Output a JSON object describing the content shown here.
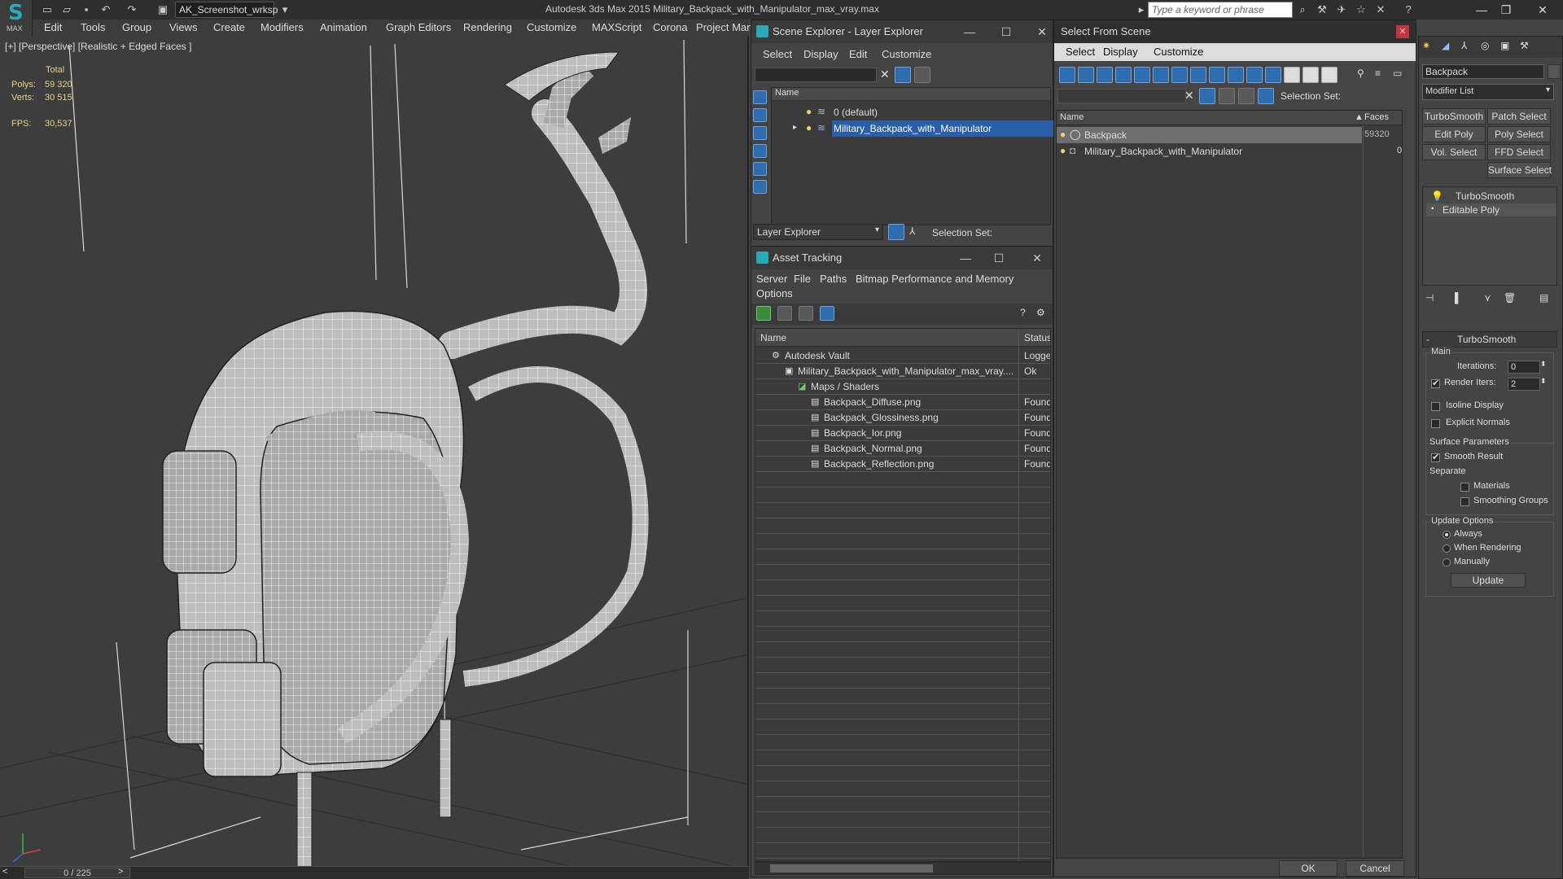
{
  "app": {
    "logo_text": "MAX",
    "title": "Autodesk 3ds Max  2015     Military_Backpack_with_Manipulator_max_vray.max",
    "workspace": "AK_Screenshot_wrksp",
    "search_placeholder": "Type a keyword or phrase"
  },
  "menu": [
    "Edit",
    "Tools",
    "Group",
    "Views",
    "Create",
    "Modifiers",
    "Animation",
    "Graph Editors",
    "Rendering",
    "Customize",
    "MAXScript",
    "Corona",
    "Project Man"
  ],
  "viewport": {
    "label": "[+] [Perspective] [Realistic + Edged Faces ]",
    "stats": {
      "total_label": "Total",
      "polys_label": "Polys:",
      "polys": "59 320",
      "verts_label": "Verts:",
      "verts": "30 515",
      "fps_label": "FPS:",
      "fps": "30,537"
    }
  },
  "timeline": {
    "frame": "0 / 225"
  },
  "scene_explorer": {
    "title": "Scene Explorer - Layer Explorer",
    "menu": [
      "Select",
      "Display",
      "Edit",
      "Customize"
    ],
    "col_name": "Name",
    "rows": [
      "0 (default)",
      "Military_Backpack_with_Manipulator"
    ],
    "footer_combo": "Layer Explorer",
    "selection_set": "Selection Set:"
  },
  "asset_tracking": {
    "title": "Asset Tracking",
    "menu": [
      "Server",
      "File",
      "Paths",
      "Bitmap Performance and Memory",
      "Options"
    ],
    "col_name": "Name",
    "col_status": "Status",
    "rows": [
      {
        "name": "Autodesk Vault",
        "status": "Logged",
        "indent": 0
      },
      {
        "name": "Military_Backpack_with_Manipulator_max_vray....",
        "status": "Ok",
        "indent": 1
      },
      {
        "name": "Maps / Shaders",
        "status": "",
        "indent": 2
      },
      {
        "name": "Backpack_Diffuse.png",
        "status": "Found",
        "indent": 3
      },
      {
        "name": "Backpack_Glossiness.png",
        "status": "Found",
        "indent": 3
      },
      {
        "name": "Backpack_Ior.png",
        "status": "Found",
        "indent": 3
      },
      {
        "name": "Backpack_Normal.png",
        "status": "Found",
        "indent": 3
      },
      {
        "name": "Backpack_Reflection.png",
        "status": "Found",
        "indent": 3
      }
    ]
  },
  "select_from_scene": {
    "title": "Select From Scene",
    "menu": [
      "Select",
      "Display",
      "Customize"
    ],
    "selection_set": "Selection Set:",
    "col_name": "Name",
    "col_faces": "Faces",
    "rows": [
      {
        "name": "Backpack",
        "faces": "59320"
      },
      {
        "name": "Military_Backpack_with_Manipulator",
        "faces": "0"
      }
    ],
    "ok": "OK",
    "cancel": "Cancel"
  },
  "command_panel": {
    "object_name": "Backpack",
    "modifier_list": "Modifier List",
    "buttons": [
      "TurboSmooth",
      "Patch Select",
      "Edit Poly",
      "Poly Select",
      "Vol. Select",
      "FFD Select",
      "Surface Select"
    ],
    "stack": [
      "TurboSmooth",
      "Editable Poly"
    ],
    "rollout_title": "TurboSmooth",
    "main_label": "Main",
    "iterations_label": "Iterations:",
    "iterations": "0",
    "render_iters_label": "Render Iters:",
    "render_iters": "2",
    "isoline": "Isoline Display",
    "explicit": "Explicit Normals",
    "surface_params": "Surface Parameters",
    "smooth_result": "Smooth Result",
    "separate": "Separate",
    "materials": "Materials",
    "smoothing_groups": "Smoothing Groups",
    "update_options": "Update Options",
    "always": "Always",
    "when_rendering": "When Rendering",
    "manually": "Manually",
    "update": "Update"
  }
}
